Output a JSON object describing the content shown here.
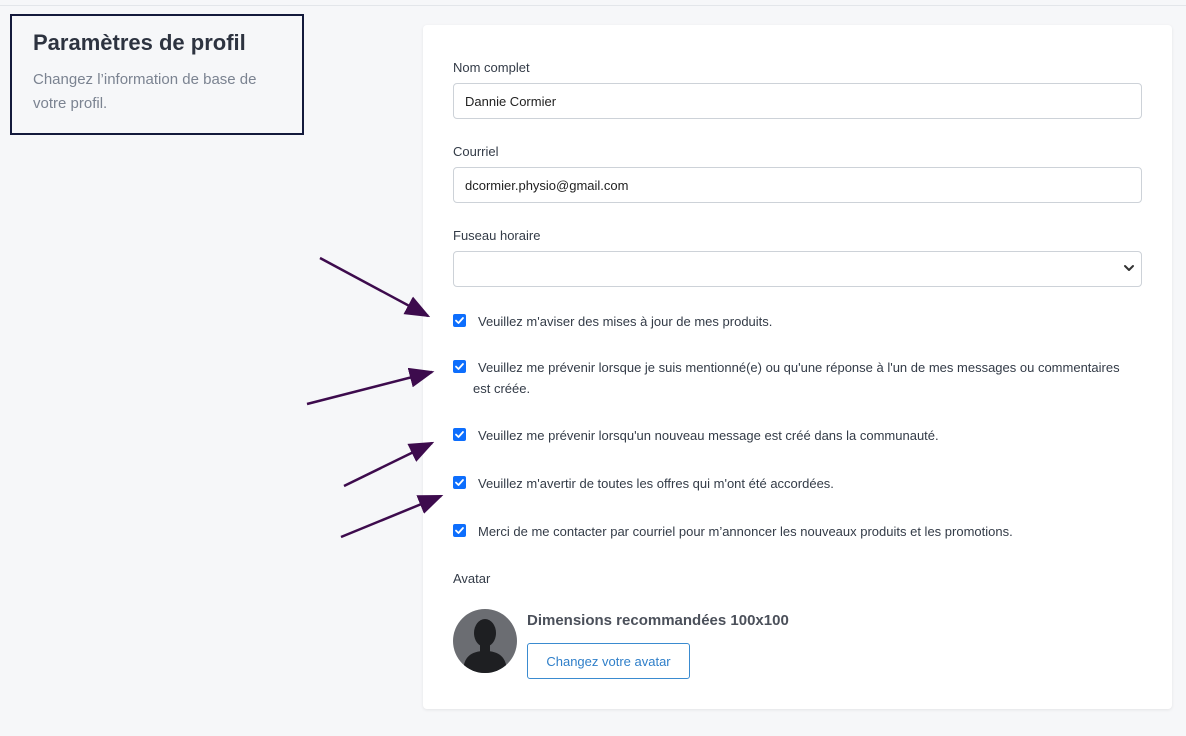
{
  "header": {
    "title": "Paramètres de profil",
    "subtitle": "Changez l’information de base de votre profil."
  },
  "form": {
    "full_name": {
      "label": "Nom complet",
      "value": "Dannie Cormier"
    },
    "email": {
      "label": "Courriel",
      "value": "dcormier.physio@gmail.com"
    },
    "timezone": {
      "label": "Fuseau horaire",
      "value": ""
    },
    "checkboxes": [
      {
        "label": "Veuillez m'aviser des mises à jour de mes produits.",
        "checked": true
      },
      {
        "label": "Veuillez me prévenir lorsque je suis mentionné(e) ou qu'une réponse à l'un de mes messages ou commentaires est créée.",
        "checked": true
      },
      {
        "label": "Veuillez me prévenir lorsqu'un nouveau message est créé dans la communauté.",
        "checked": true
      },
      {
        "label": "Veuillez m'avertir de toutes les offres qui m'ont été accordées.",
        "checked": true
      },
      {
        "label": "Merci de me contacter par courriel pour m’annoncer les nouveaux produits et les promotions.",
        "checked": true
      }
    ],
    "avatar": {
      "label": "Avatar",
      "dimensions_text": "Dimensions recommandées 100x100",
      "button_label": "Changez votre avatar"
    }
  },
  "colors": {
    "checkbox": "#0d6efd",
    "arrow": "#3d0b4d",
    "header_border": "#141a3c",
    "button_accent": "#2f7fc9"
  }
}
